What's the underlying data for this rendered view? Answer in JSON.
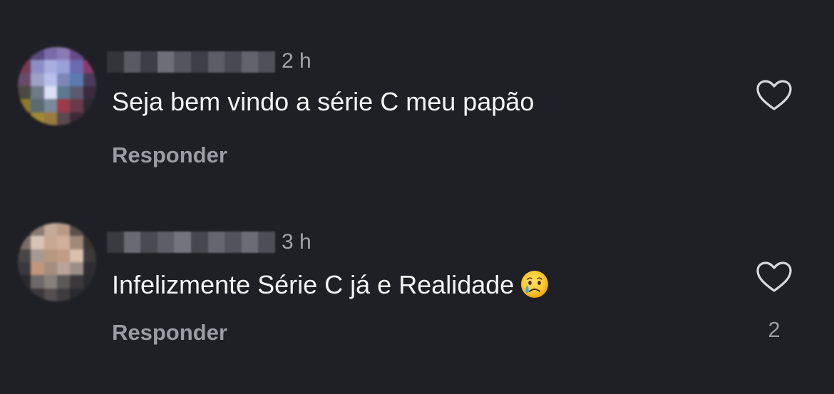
{
  "comments": [
    {
      "time": "2 h",
      "text": "Seja bem vindo a série C meu papão",
      "reply_label": "Responder",
      "likes": "",
      "emoji": ""
    },
    {
      "time": "3 h",
      "text": "Infelizmente Série C já e Realidade",
      "reply_label": "Responder",
      "likes": "2",
      "emoji": "crying-face"
    }
  ],
  "colors": {
    "background": "#1f2025",
    "text": "#f3f3f5",
    "muted": "#9a9ca3"
  },
  "icons": [
    "heart-outline-icon",
    "crying-face-emoji"
  ]
}
